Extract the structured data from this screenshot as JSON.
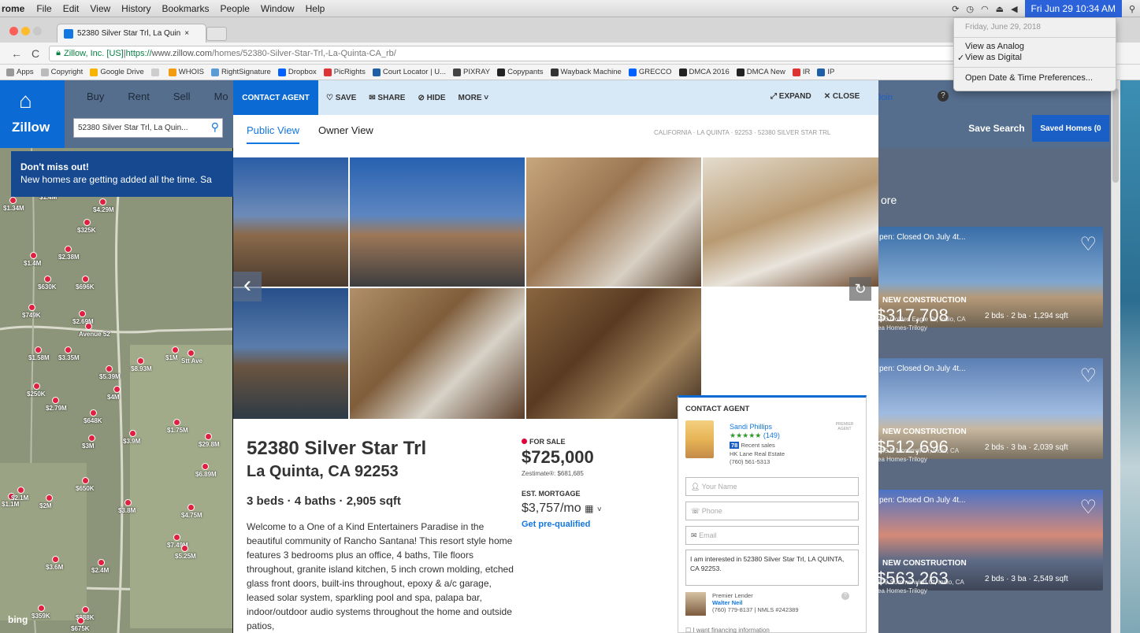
{
  "menubar": {
    "app": "rome",
    "items": [
      "File",
      "Edit",
      "View",
      "History",
      "Bookmarks",
      "People",
      "Window",
      "Help"
    ],
    "clock": "Fri Jun 29  10:34 AM",
    "search_icon": "magnifier-icon"
  },
  "dropdown": {
    "date": "Friday, June 29, 2018",
    "analog": "View as Analog",
    "digital": "View as Digital",
    "check": "✓",
    "prefs": "Open Date & Time Preferences..."
  },
  "browser": {
    "tab_title": "52380 Silver Star Trl, La Quin",
    "tab_close": "×",
    "url_secure": "Zillow, Inc. [US]",
    "url_sep": " | ",
    "url_scheme": "https://",
    "url_host": "www.zillow.com",
    "url_path": "/homes/52380-Silver-Star-Trl,-La-Quinta-CA_rb/",
    "bookmarks": [
      {
        "label": "Apps",
        "color": "#999"
      },
      {
        "label": "Copyright",
        "color": "#bbb"
      },
      {
        "label": "Google Drive",
        "color": "#f5b400"
      },
      {
        "label": "",
        "color": "#ccc"
      },
      {
        "label": "WHOIS",
        "color": "#f39c12"
      },
      {
        "label": "RightSignature",
        "color": "#5b9bd5"
      },
      {
        "label": "Dropbox",
        "color": "#0061fe"
      },
      {
        "label": "PicRights",
        "color": "#d33"
      },
      {
        "label": "Court Locator | U...",
        "color": "#1f5fa8"
      },
      {
        "label": "PIXRAY",
        "color": "#444"
      },
      {
        "label": "Copypants",
        "color": "#222"
      },
      {
        "label": "Wayback Machine",
        "color": "#333"
      },
      {
        "label": "GRECCO",
        "color": "#0061fe"
      },
      {
        "label": "DMCA 2016",
        "color": "#222"
      },
      {
        "label": "DMCA New",
        "color": "#222"
      },
      {
        "label": "IR",
        "color": "#d33"
      },
      {
        "label": "IP",
        "color": "#1f5fa8"
      }
    ]
  },
  "zillow": {
    "logo": "Zillow",
    "nav": [
      "Buy",
      "Rent",
      "Sell",
      "Mo"
    ],
    "search_value": "52380 Silver Star Trl, La Quin...",
    "save_search": "Save Search",
    "saved_homes": "Saved Homes (0",
    "signin": "or Join",
    "banner_title": "Don't miss out!",
    "banner_text": "New homes are getting added all the time. Sa"
  },
  "map_labels": [
    "$1.4M",
    "$4.29M",
    "$1.34M",
    "$325K",
    "$2.38M",
    "$1.4M",
    "$630K",
    "$696K",
    "$749K",
    "$2.69M",
    "Avenue 52",
    "$1.58M",
    "$3.35M",
    "$1M",
    "$8.93M",
    "$5.39M",
    "$250K",
    "$4M",
    "$2.79M",
    "$648K",
    "$1.75M",
    "$29.8M",
    "$3.9M",
    "$6.89M",
    "$3M",
    "$650K",
    "$1.1M",
    "$2M",
    "$4.75M",
    "$7.49M",
    "$5.25M",
    "$3.6M",
    "$2.4M",
    "$359K",
    "$888K",
    "$675K",
    "Stt Ave",
    "$2.1M",
    "$3.8M"
  ],
  "map_credit": "bing",
  "modal": {
    "contact_agent": "CONTACT AGENT",
    "save": "SAVE",
    "share": "SHARE",
    "hide": "HIDE",
    "more": "MORE",
    "expand": "EXPAND",
    "close": "CLOSE",
    "view_public": "Public View",
    "view_owner": "Owner View",
    "breadcrumb": "California · La Quinta · 92253 · 52380 SILVER STAR TRL",
    "title_line1": "52380 Silver Star Trl",
    "title_line2": "La Quinta, CA 92253",
    "facts": "3 beds · 4 baths · 2,905 sqft",
    "description": "Welcome to a One of a Kind Entertainers Paradise in the beautiful community of Rancho Santana! This resort style home features 3 bedrooms plus an office, 4 baths, Tile floors throughout, granite island kitchen, 5 inch crown molding, etched glass front doors, built-ins throughout, epoxy & a/c garage, leased solar system, sparkling pool and spa, palapa bar, indoor/outdoor audio systems throughout the home and outside patios,",
    "for_sale": "FOR SALE",
    "price": "$725,000",
    "zestimate": "Zestimate®: $681,685",
    "mortgage_label": "EST. MORTGAGE",
    "mortgage": "$3,757/mo",
    "prequalified": "Get pre-qualified"
  },
  "contact": {
    "title": "CONTACT AGENT",
    "agent_name": "Sandi Phillips",
    "stars": "★★★★★",
    "reviews": "(149)",
    "recent_count": "78",
    "recent_label": "Recent sales",
    "broker": "HK Lane Real Estate",
    "phone": "(760) 561-5313",
    "badge": "PREMIER AGENT",
    "name_placeholder": "Your Name",
    "phone_placeholder": "Phone",
    "email_placeholder": "Email",
    "message": "I am interested in 52380 Silver Star Trl, LA QUINTA, CA 92253.",
    "lender_label": "Premier Lender",
    "lender_name": "Walter Neil",
    "lender_phone": "(760) 779-8137 | NMLS #242389",
    "financing": "I want financing information"
  },
  "listings": {
    "more": "ore",
    "cards": [
      {
        "status": "pen: Closed On July 4t...",
        "tag": "NEW CONSTRUCTION",
        "price": "$317,708",
        "details": "2 bds · 2 ba · 1,294 sqft",
        "addr": "780 Golden Eagle Dr, Indio, CA"
      },
      {
        "status": "pen: Closed On July 4t...",
        "tag": "NEW CONSTRUCTION",
        "price": "$512,696",
        "details": "2 bds · 3 ba · 2,039 sqft",
        "addr": "545 E Mccarroll Dr, Indio, CA"
      },
      {
        "status": "pen: Closed On July 4t...",
        "tag": "NEW CONSTRUCTION",
        "price": "$563,263",
        "details": "2 bds · 3 ba · 2,549 sqft",
        "addr": "579 Summerwind Ct, Indio, CA"
      }
    ],
    "builder": "ea Homes-Trilogy"
  }
}
